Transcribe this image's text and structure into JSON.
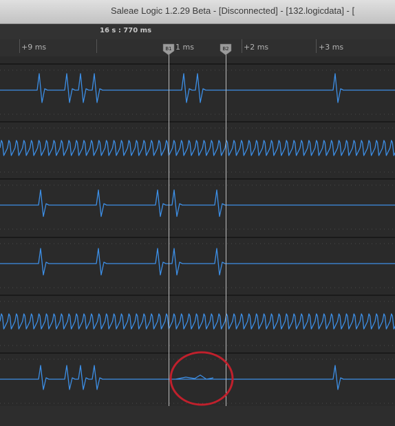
{
  "window": {
    "title": "Saleae Logic 1.2.29 Beta - [Disconnected] - [132.logicdata] - ["
  },
  "timeline": {
    "reference_time": "16 s : 770 ms",
    "ticks": [
      {
        "label": "+9 ms"
      },
      {
        "label": "1 ms"
      },
      {
        "label": "+2 ms"
      },
      {
        "label": "+3 ms"
      }
    ]
  },
  "markers": [
    {
      "label": "B1"
    },
    {
      "label": "B2"
    }
  ],
  "colors": {
    "signal": "#3d8fe6",
    "highlight_circle": "#c0202c",
    "cursor_line": "#b8b8b8",
    "background": "#2a2a2a"
  },
  "channels": [
    {
      "pattern": "spikes-a"
    },
    {
      "pattern": "dense-wave"
    },
    {
      "pattern": "spikes-b"
    },
    {
      "pattern": "spikes-b"
    },
    {
      "pattern": "dense-wave"
    },
    {
      "pattern": "spikes-c"
    }
  ]
}
